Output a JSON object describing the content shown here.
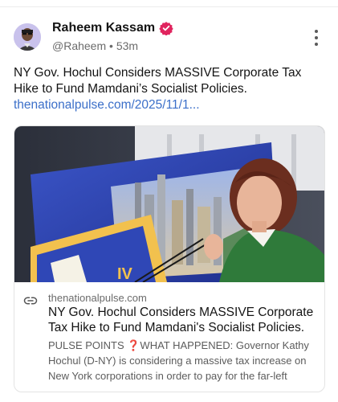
{
  "post": {
    "author": {
      "name": "Raheem Kassam",
      "handle": "@Raheem",
      "separator": "•",
      "time": "53m"
    },
    "text": "NY Gov. Hochul Considers MASSIVE Corporate Tax Hike to Fund Mamdani’s Socialist Policies.",
    "link_text": "thenationalpulse.com/2025/11/1...",
    "link_card": {
      "domain": "thenationalpulse.com",
      "title": "NY Gov. Hochul Considers MASSIVE Corporate Tax Hike to Fund Mamdani's Socialist Policies.",
      "description": "PULSE POINTS ❓WHAT HAPPENED: Governor Kathy Hochul (D-NY) is considering a massive tax increase on New York corporations in order to pay for the far-left",
      "image_overlay_text": "IV"
    }
  },
  "icons": {
    "verified": "verified-badge-icon",
    "more": "more-vertical-icon",
    "link": "link-icon"
  },
  "colors": {
    "verified_badge": "#e0245e",
    "link": "#3b6fc9",
    "secondary_text": "#6b6b6b"
  }
}
